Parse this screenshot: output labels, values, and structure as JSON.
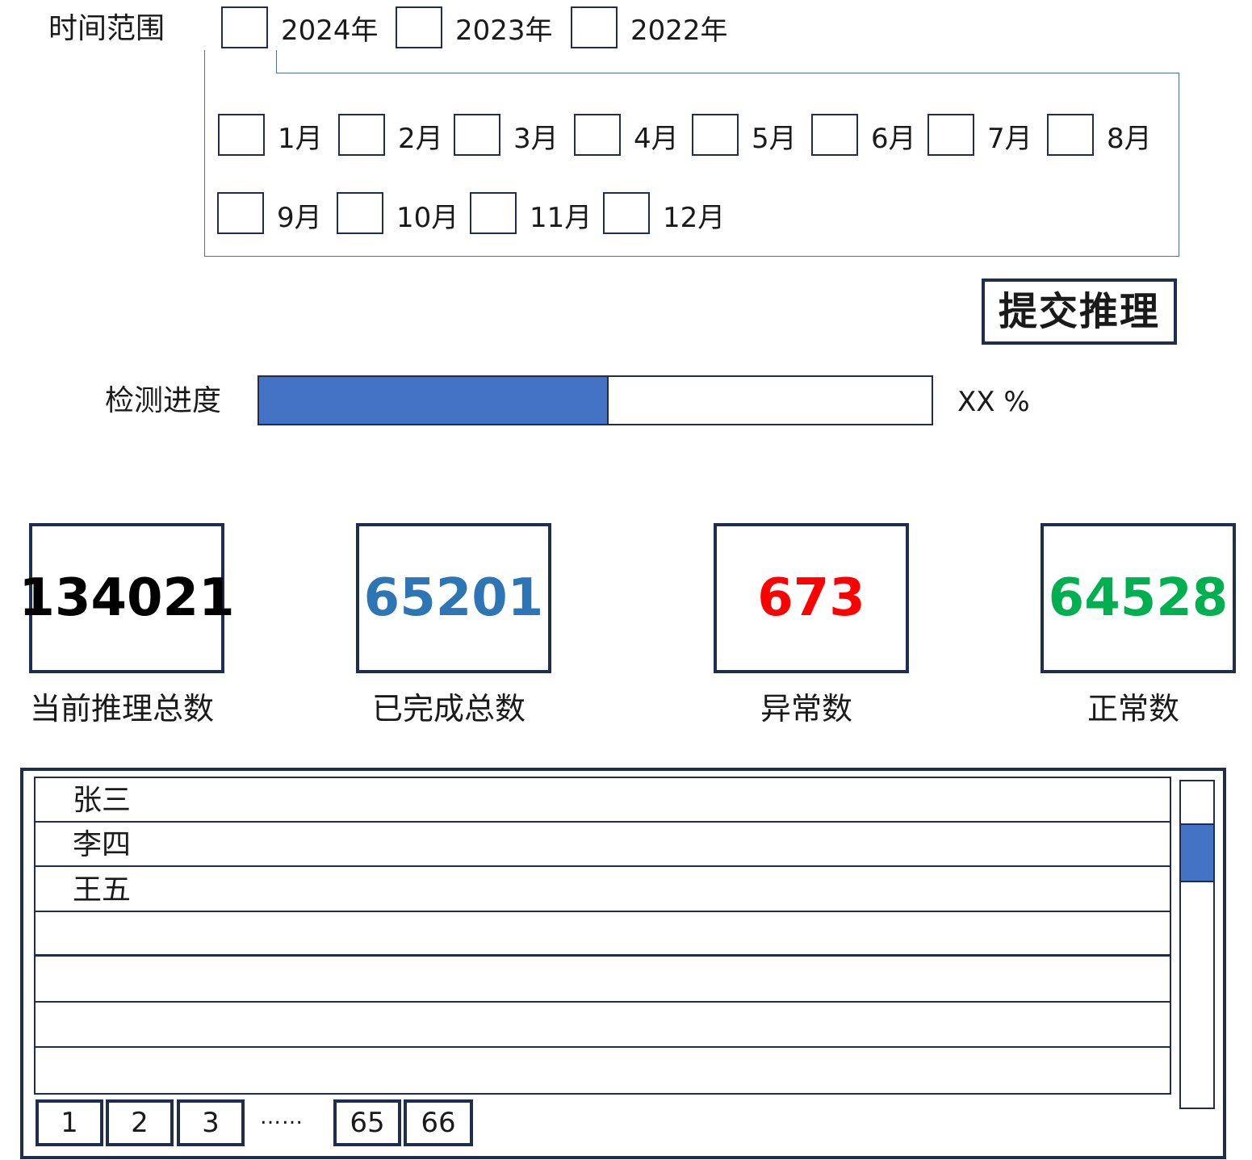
{
  "time_range": {
    "label": "时间范围",
    "years": [
      "2024年",
      "2023年",
      "2022年"
    ],
    "months": [
      "1月",
      "2月",
      "3月",
      "4月",
      "5月",
      "6月",
      "7月",
      "8月",
      "9月",
      "10月",
      "11月",
      "12月"
    ]
  },
  "submit_label": "提交推理",
  "progress": {
    "label": "检测进度",
    "value_text": "XX %",
    "fraction": 0.52,
    "fill_color": "#4472c4"
  },
  "stats": [
    {
      "value": "134021",
      "label": "当前推理总数",
      "color": "#000000"
    },
    {
      "value": "65201",
      "label": "已完成总数",
      "color": "#2e75b6"
    },
    {
      "value": "673",
      "label": "异常数",
      "color": "#ff0000"
    },
    {
      "value": "64528",
      "label": "正常数",
      "color": "#00b050"
    }
  ],
  "list": {
    "rows": [
      "张三",
      "李四",
      "王五",
      "",
      "",
      "",
      ""
    ]
  },
  "pagination": {
    "pages": [
      "1",
      "2",
      "3",
      "65",
      "66"
    ],
    "ellipsis": "……"
  }
}
